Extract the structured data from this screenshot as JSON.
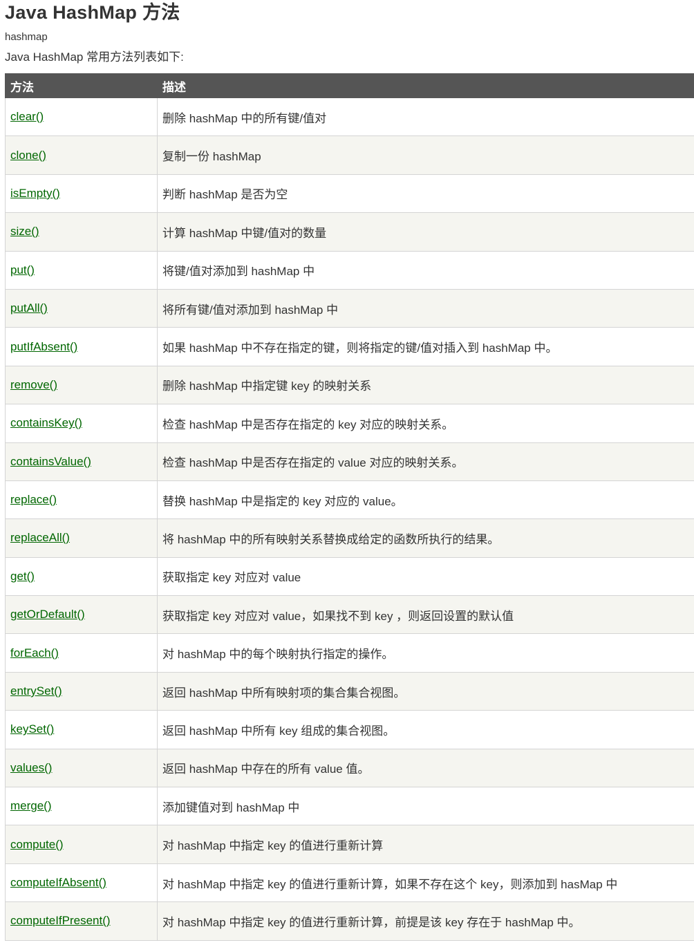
{
  "page": {
    "title": "Java HashMap 方法",
    "subtitle": "hashmap",
    "intro": "Java HashMap 常用方法列表如下:"
  },
  "table": {
    "headers": [
      "方法",
      "描述"
    ],
    "rows": [
      {
        "method": "clear()",
        "description": "删除 hashMap 中的所有键/值对"
      },
      {
        "method": "clone()",
        "description": "复制一份 hashMap"
      },
      {
        "method": "isEmpty()",
        "description": "判断 hashMap 是否为空"
      },
      {
        "method": "size()",
        "description": "计算 hashMap 中键/值对的数量"
      },
      {
        "method": "put()",
        "description": "将键/值对添加到 hashMap 中"
      },
      {
        "method": "putAll()",
        "description": "将所有键/值对添加到 hashMap 中"
      },
      {
        "method": "putIfAbsent()",
        "description": "如果 hashMap 中不存在指定的键，则将指定的键/值对插入到 hashMap 中。"
      },
      {
        "method": "remove()",
        "description": "删除 hashMap 中指定键 key 的映射关系"
      },
      {
        "method": "containsKey()",
        "description": "检查 hashMap 中是否存在指定的 key 对应的映射关系。"
      },
      {
        "method": "containsValue()",
        "description": "检查 hashMap 中是否存在指定的 value 对应的映射关系。"
      },
      {
        "method": "replace()",
        "description": "替换 hashMap 中是指定的 key 对应的 value。"
      },
      {
        "method": "replaceAll()",
        "description": "将 hashMap 中的所有映射关系替换成给定的函数所执行的结果。"
      },
      {
        "method": "get()",
        "description": "获取指定 key 对应对 value"
      },
      {
        "method": "getOrDefault()",
        "description": "获取指定 key 对应对 value，如果找不到 key ，则返回设置的默认值"
      },
      {
        "method": "forEach()",
        "description": "对 hashMap 中的每个映射执行指定的操作。"
      },
      {
        "method": "entrySet()",
        "description": "返回 hashMap 中所有映射项的集合集合视图。"
      },
      {
        "method": "keySet()",
        "description": "返回 hashMap 中所有 key 组成的集合视图。"
      },
      {
        "method": "values()",
        "description": "返回 hashMap 中存在的所有 value 值。"
      },
      {
        "method": "merge()",
        "description": "添加键值对到 hashMap 中"
      },
      {
        "method": "compute()",
        "description": "对 hashMap 中指定 key 的值进行重新计算"
      },
      {
        "method": "computeIfAbsent()",
        "description": "对 hashMap 中指定 key 的值进行重新计算，如果不存在这个 key，则添加到 hasMap 中"
      },
      {
        "method": "computeIfPresent()",
        "description": "对 hashMap 中指定 key 的值进行重新计算，前提是该 key 存在于 hashMap 中。"
      }
    ]
  },
  "colors": {
    "header_bg": "#555555",
    "link": "#006600",
    "row_alt_bg": "#f5f5f0"
  }
}
